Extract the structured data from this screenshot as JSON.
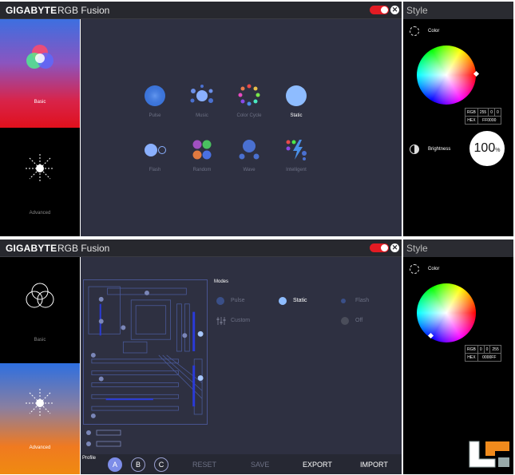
{
  "panel1": {
    "brand": "GIGABYTE",
    "app_title": "RGB Fusion",
    "style_title": "Style",
    "sidebar": {
      "basic_label": "Basic",
      "advanced_label": "Advanced"
    },
    "modes": [
      {
        "label": "Pulse",
        "icon": "pulse-icon"
      },
      {
        "label": "Music",
        "icon": "music-icon"
      },
      {
        "label": "Color Cycle",
        "icon": "color-cycle-icon"
      },
      {
        "label": "Static",
        "icon": "static-icon",
        "active": true
      },
      {
        "label": "Flash",
        "icon": "flash-icon"
      },
      {
        "label": "Random",
        "icon": "random-icon"
      },
      {
        "label": "Wave",
        "icon": "wave-icon"
      },
      {
        "label": "Intelligent",
        "icon": "intelligent-icon"
      }
    ],
    "color": {
      "label": "Color",
      "rgb_label": "RGB",
      "r": "255",
      "g": "0",
      "b": "0",
      "hex_label": "HEX",
      "hex": "FF0000"
    },
    "brightness": {
      "label": "Brightness",
      "value": "100",
      "unit": "%"
    }
  },
  "panel2": {
    "brand": "GIGABYTE",
    "app_title": "RGB Fusion",
    "style_title": "Style",
    "sidebar": {
      "basic_label": "Basic",
      "advanced_label": "Advanced"
    },
    "modes_title": "Modes",
    "modes": [
      {
        "label": "Pulse"
      },
      {
        "label": "Static",
        "active": true
      },
      {
        "label": "Flash"
      },
      {
        "label": "Custom"
      },
      {
        "label": "Off"
      }
    ],
    "profile": {
      "label": "Profile",
      "buttons": [
        "A",
        "B",
        "C"
      ]
    },
    "actions": {
      "reset": "RESET",
      "save": "SAVE",
      "export": "EXPORT",
      "import": "IMPORT"
    },
    "color": {
      "label": "Color",
      "rgb_label": "RGB",
      "r": "0",
      "g": "0",
      "b": "255",
      "hex_label": "HEX",
      "hex": "0000FF"
    }
  },
  "colors": {
    "accent_red": "#e31b23",
    "main_bg": "#2e3041",
    "profile_active": "#7d8de8"
  }
}
